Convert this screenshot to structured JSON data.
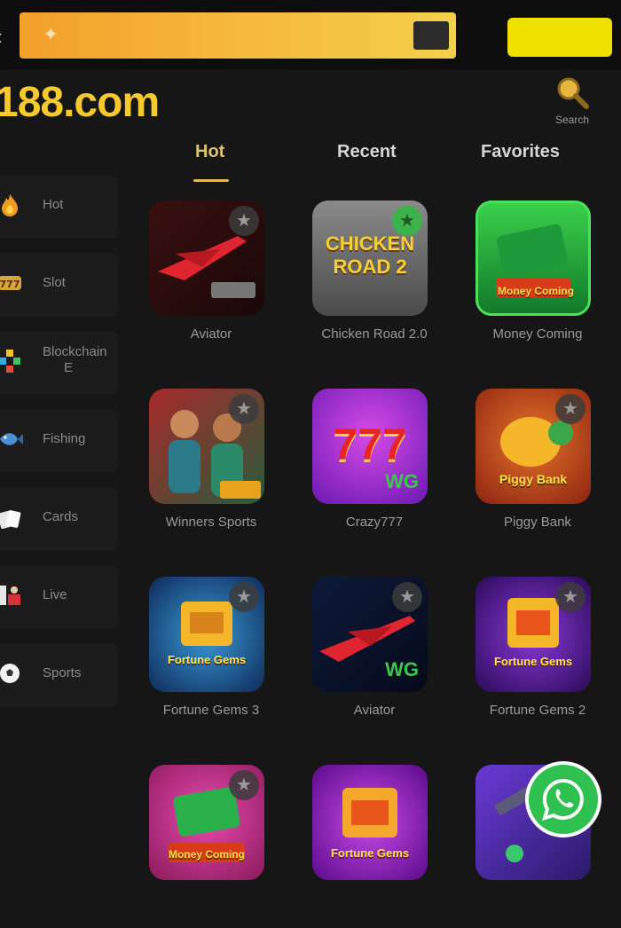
{
  "header": {
    "banner_close_label": "",
    "cta_label": "",
    "brand": "188.com",
    "search_label": "Search"
  },
  "tabs": [
    {
      "label": "Hot",
      "active": true
    },
    {
      "label": "Recent",
      "active": false
    },
    {
      "label": "Favorites",
      "active": false
    }
  ],
  "sidebar": [
    {
      "label": "Hot",
      "icon": "fire-icon"
    },
    {
      "label": "Slot",
      "icon": "slot-777-icon"
    },
    {
      "label": "Blockchain",
      "sub": "E",
      "icon": "blockchain-icon"
    },
    {
      "label": "Fishing",
      "icon": "fish-icon"
    },
    {
      "label": "Cards",
      "icon": "cards-icon"
    },
    {
      "label": "Live",
      "icon": "live-dealer-icon"
    },
    {
      "label": "Sports",
      "icon": "soccer-ball-icon"
    }
  ],
  "games": [
    {
      "name": "Aviator",
      "art": "Aviator"
    },
    {
      "name": "Chicken Road 2.0",
      "art": "CHICKEN ROAD 2"
    },
    {
      "name": "Money Coming",
      "art": "Money Coming"
    },
    {
      "name": "Winners Sports",
      "art": "Winners"
    },
    {
      "name": "Crazy777",
      "art": "777"
    },
    {
      "name": "Piggy Bank",
      "art": "Piggy Bank"
    },
    {
      "name": "Fortune Gems 3",
      "art": "Fortune Gems"
    },
    {
      "name": "Aviator",
      "art": "Aviator"
    },
    {
      "name": "Fortune Gems 2",
      "art": "Fortune Gems"
    },
    {
      "name": "",
      "art": "Money Coming"
    },
    {
      "name": "",
      "art": "Fortune Gems"
    },
    {
      "name": "",
      "art": ""
    }
  ],
  "colors": {
    "background": "#161616",
    "accent_gold": "#f6ca2c",
    "banner_orange": "#f2a02a",
    "cta_yellow": "#f0e000",
    "whatsapp_green": "#2fc14f"
  }
}
